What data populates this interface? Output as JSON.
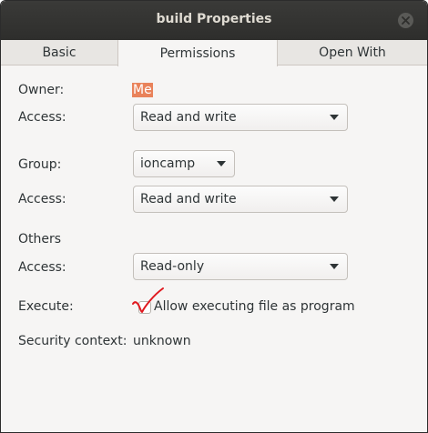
{
  "window": {
    "title": "build Properties"
  },
  "tabs": [
    {
      "label": "Basic",
      "active": false
    },
    {
      "label": "Permissions",
      "active": true
    },
    {
      "label": "Open With",
      "active": false
    }
  ],
  "permissions": {
    "owner_label": "Owner:",
    "owner_value": "Me",
    "owner_access_label": "Access:",
    "owner_access_value": "Read and write",
    "group_label": "Group:",
    "group_value": "ioncamp",
    "group_access_label": "Access:",
    "group_access_value": "Read and write",
    "others_label": "Others",
    "others_access_label": "Access:",
    "others_access_value": "Read-only",
    "execute_label": "Execute:",
    "execute_checkbox_label": "Allow executing file as program",
    "execute_checked": false,
    "security_context_label": "Security context:",
    "security_context_value": "unknown"
  },
  "icons": {
    "close": "close-icon",
    "dropdown": "chevron-down-icon",
    "annotation": "red-checkmark-annotation"
  },
  "colors": {
    "titlebar": "#2e2e2c",
    "window_bg": "#f6f5f4",
    "owner_highlight": "#e9825a",
    "annotation_red": "#e0191f"
  }
}
